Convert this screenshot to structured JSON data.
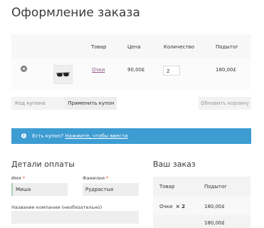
{
  "page": {
    "title": "Оформление заказа"
  },
  "cart": {
    "columns": [
      "Товар",
      "Цена",
      "Количество",
      "Подытог"
    ],
    "items": [
      {
        "name": "Очки",
        "price": "90,00£",
        "quantity": "2",
        "subtotal": "180,00£"
      }
    ],
    "coupon_placeholder": "Код купона",
    "apply_coupon_label": "Применить купон",
    "update_cart_label": "Обновить корзину"
  },
  "notice": {
    "text": "Есть купон?",
    "link": "Нажмите, чтобы ввести",
    "icon": "info-icon"
  },
  "billing": {
    "title": "Детали оплаты",
    "first_name_label": "Имя",
    "first_name_value": "Миша",
    "last_name_label": "Фамилия",
    "last_name_value": "Рудрастых",
    "company_label": "Название компании (необязательно)",
    "company_value": "",
    "required_mark": "*"
  },
  "order": {
    "title": "Ваш заказ",
    "columns": [
      "Товар",
      "Подытог"
    ],
    "rows": [
      {
        "product": "Очки",
        "qty": "× 2",
        "subtotal": "180,00£"
      },
      {
        "product": "",
        "qty": "",
        "subtotal": "180,00£"
      }
    ]
  },
  "colors": {
    "notice_bg": "#3d9cd2",
    "link": "#96588a",
    "required": "#e2401c"
  }
}
